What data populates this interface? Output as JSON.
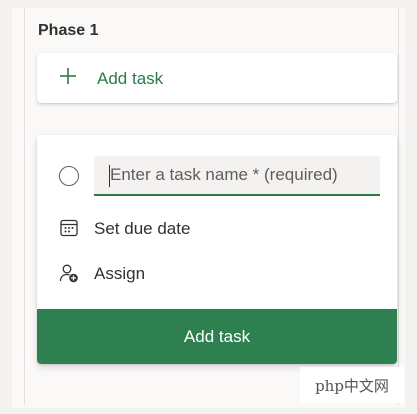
{
  "column": {
    "title": "Phase 1",
    "add_task_label": "Add task"
  },
  "new_task": {
    "name_placeholder": "Enter a task name * (required)",
    "due_date_label": "Set due date",
    "assign_label": "Assign",
    "submit_label": "Add task"
  },
  "icons": {
    "add": "plus-icon",
    "complete": "circle-icon",
    "due_date": "calendar-icon",
    "assign": "person-add-icon"
  },
  "colors": {
    "accent": "#2e8050",
    "accent_text": "#2b7a4b",
    "text": "#323130"
  },
  "watermark": "php中文网"
}
